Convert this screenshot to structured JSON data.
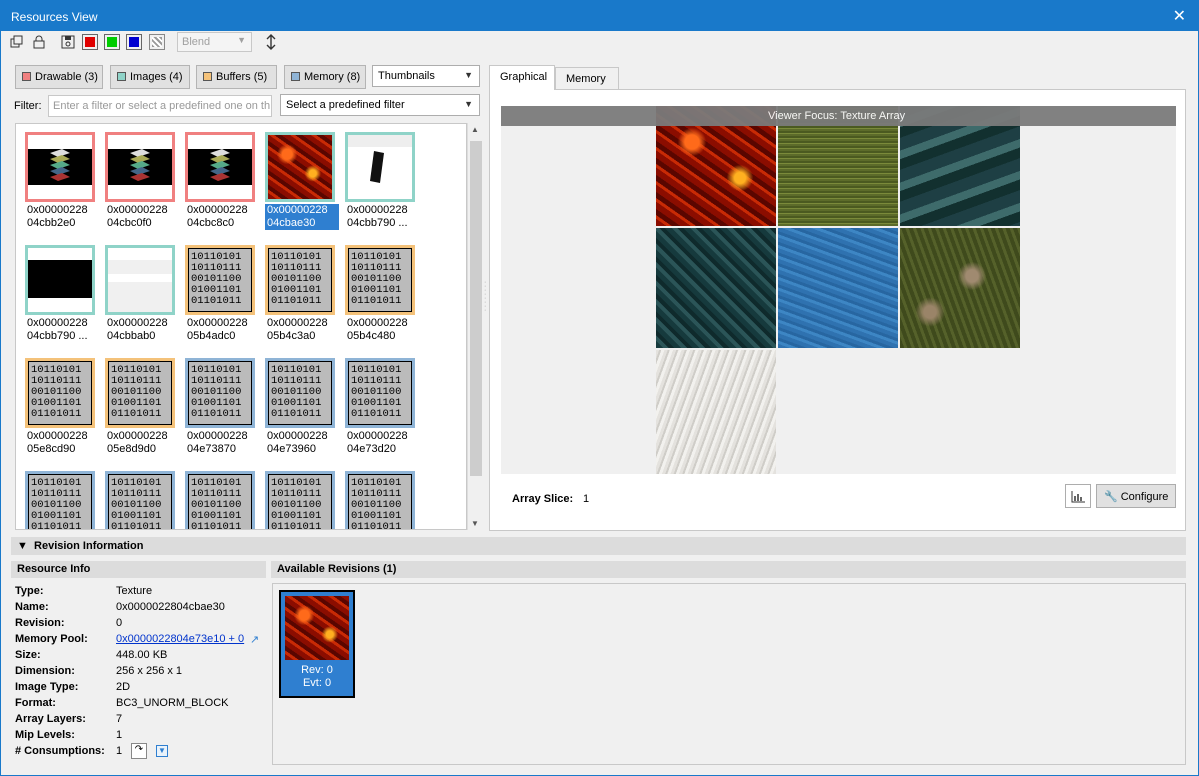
{
  "window": {
    "title": "Resources View",
    "close": "✕"
  },
  "toolbar": {
    "blend_label": "Blend",
    "colors": {
      "red": "#e00000",
      "green": "#00cc00",
      "blue": "#0000d0"
    }
  },
  "filters": {
    "drawable": "Drawable (3)",
    "images": "Images (4)",
    "buffers": "Buffers (5)",
    "memory": "Memory (8)",
    "view_mode": "Thumbnails",
    "filter_label": "Filter:",
    "filter_placeholder": "Enter a filter or select a predefined one on th",
    "predefined": "Select a predefined filter"
  },
  "thumbnails": [
    {
      "l1": "0x00000228",
      "l2": "04cbb2e0"
    },
    {
      "l1": "0x00000228",
      "l2": "04cbc0f0"
    },
    {
      "l1": "0x00000228",
      "l2": "04cbc8c0"
    },
    {
      "l1": "0x00000228",
      "l2": "04cbae30"
    },
    {
      "l1": "0x00000228",
      "l2": "04cbb790 ..."
    },
    {
      "l1": "0x00000228",
      "l2": "04cbb790 ..."
    },
    {
      "l1": "0x00000228",
      "l2": "04cbbab0"
    },
    {
      "l1": "0x00000228",
      "l2": "05b4adc0"
    },
    {
      "l1": "0x00000228",
      "l2": "05b4c3a0"
    },
    {
      "l1": "0x00000228",
      "l2": "05b4c480"
    },
    {
      "l1": "0x00000228",
      "l2": "05e8cd90"
    },
    {
      "l1": "0x00000228",
      "l2": "05e8d9d0"
    },
    {
      "l1": "0x00000228",
      "l2": "04e73870"
    },
    {
      "l1": "0x00000228",
      "l2": "04e73960"
    },
    {
      "l1": "0x00000228",
      "l2": "04e73d20"
    }
  ],
  "binary_text": [
    "10110101",
    "10110111",
    "00101100",
    "01001101",
    "01101011"
  ],
  "tabs": {
    "graphical": "Graphical",
    "memory": "Memory"
  },
  "viewer": {
    "focus": "Viewer Focus: Texture Array",
    "array_slice_label": "Array Slice:",
    "array_slice_value": "1",
    "configure": "Configure"
  },
  "revision": {
    "section": "Revision Information",
    "resource_info": "Resource Info",
    "available": "Available Revisions (1)",
    "props": [
      {
        "k": "Type:",
        "v": "Texture"
      },
      {
        "k": "Name:",
        "v": "0x0000022804cbae30"
      },
      {
        "k": "Revision:",
        "v": "0"
      },
      {
        "k": "Memory Pool:",
        "v": "0x0000022804e73e10 + 0"
      },
      {
        "k": "Size:",
        "v": "448.00 KB"
      },
      {
        "k": "Dimension:",
        "v": "256 x 256 x 1"
      },
      {
        "k": "Image Type:",
        "v": "2D"
      },
      {
        "k": "Format:",
        "v": "BC3_UNORM_BLOCK"
      },
      {
        "k": "Array Layers:",
        "v": "7"
      },
      {
        "k": "Mip Levels:",
        "v": "1"
      },
      {
        "k": "# Consumptions:",
        "v": "1"
      }
    ],
    "rev_label": "Rev: 0",
    "evt_label": "Evt: 0"
  }
}
